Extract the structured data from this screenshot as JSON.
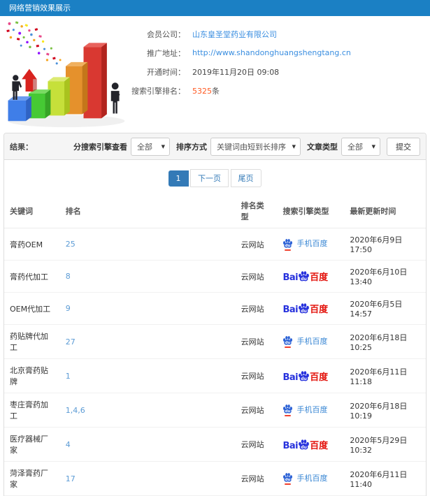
{
  "header": {
    "title": "网络营销效果展示"
  },
  "info": {
    "rows": [
      {
        "label": "会员公司：",
        "value": "山东皇圣堂药业有限公司"
      },
      {
        "label": "推广地址：",
        "value": "http://www.shandonghuangshengtang.cn"
      },
      {
        "label": "开通时间：",
        "value": "2019年11月20日 09:08"
      },
      {
        "label": "搜索引擎排名：",
        "value": "5325",
        "suffix": "条"
      }
    ]
  },
  "filters": {
    "result_label": "结果：",
    "engine_label": "分搜索引擎查看",
    "engine_value": "全部",
    "sort_label": "排序方式",
    "sort_value": "关键词由短到长排序",
    "article_label": "文章类型",
    "article_value": "全部",
    "submit_label": "提交"
  },
  "pagination": {
    "current": "1",
    "next": "下一页",
    "last": "尾页"
  },
  "table": {
    "headers": [
      "关键词",
      "排名",
      "排名类型",
      "搜索引擎类型",
      "最新更新时间"
    ],
    "rows": [
      {
        "keyword": "膏药OEM",
        "rank": "25",
        "rank_type": "云网站",
        "engine": "mobile",
        "updated": "2020年6月9日 17:50"
      },
      {
        "keyword": "膏药代加工",
        "rank": "8",
        "rank_type": "云网站",
        "engine": "pc",
        "updated": "2020年6月10日 13:40"
      },
      {
        "keyword": "OEM代加工",
        "rank": "9",
        "rank_type": "云网站",
        "engine": "pc",
        "updated": "2020年6月5日 14:57"
      },
      {
        "keyword": "药贴牌代加工",
        "rank": "27",
        "rank_type": "云网站",
        "engine": "mobile",
        "updated": "2020年6月18日 10:25"
      },
      {
        "keyword": "北京膏药贴牌",
        "rank": "1",
        "rank_type": "云网站",
        "engine": "pc",
        "updated": "2020年6月11日 11:18"
      },
      {
        "keyword": "枣庄膏药加工",
        "rank": "1,4,6",
        "rank_type": "云网站",
        "engine": "mobile",
        "updated": "2020年6月18日 10:19"
      },
      {
        "keyword": "医疗器械厂家",
        "rank": "4",
        "rank_type": "云网站",
        "engine": "pc",
        "updated": "2020年5月29日 10:32"
      },
      {
        "keyword": "菏泽膏药厂家",
        "rank": "17",
        "rank_type": "云网站",
        "engine": "mobile",
        "updated": "2020年6月11日 11:40"
      }
    ]
  },
  "engine_logos": {
    "mobile_label": "手机百度",
    "pc_bai": "Bai",
    "paw_du": "du",
    "pc_cn": "百度"
  },
  "colors": {
    "header_blue": "#1b80c4",
    "link_blue": "#3a8ee0",
    "rank_blue": "#5b9bd5",
    "highlight_orange": "#ff5a22",
    "pagination_active": "#337ab7",
    "baidu_blue": "#2732dd",
    "baidu_red": "#e3120b",
    "mobile_baidu_blue": "#3a87d4"
  }
}
